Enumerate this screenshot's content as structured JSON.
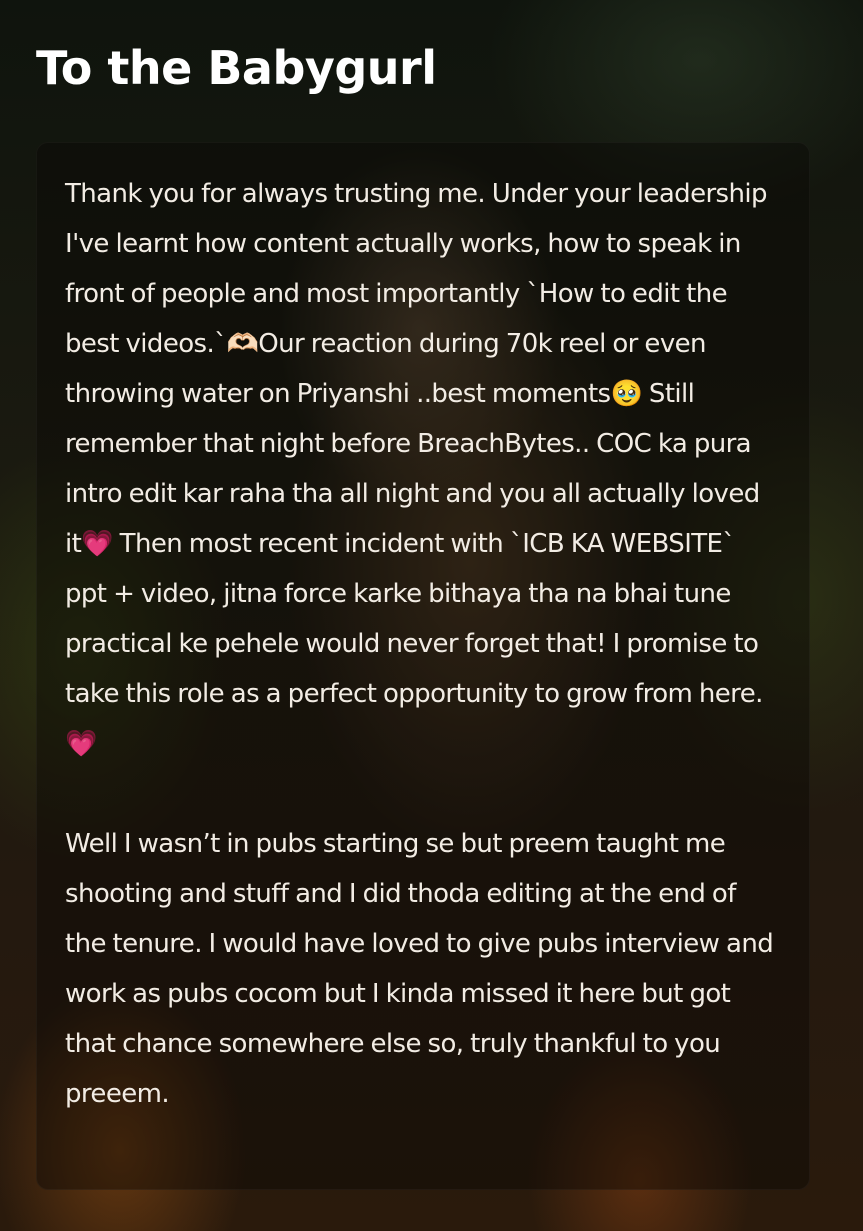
{
  "header": {
    "title": "To the Babygurl"
  },
  "letter": {
    "paragraphs": [
      "Thank you for always trusting me. Under your leadership I've learnt how content actually works, how to speak in front of people and most importantly `How to edit the best videos.`🫶🏻Our reaction during 70k reel or even throwing water on Priyanshi ..best moments🥹 Still remember that night before BreachBytes.. COC ka pura intro edit kar raha tha all night and you all actually loved it💗 Then most recent incident with `ICB KA WEBSITE` ppt + video, jitna force karke bithaya tha na bhai tune practical ke pehele would never forget that! I promise to take this role as a perfect opportunity to grow from here.💗",
      "Well I wasn’t in pubs starting se but preem taught me shooting and stuff and I did thoda editing at the end of the tenure. I would have loved to give pubs interview and work as pubs cocom but I kinda missed it here but got that chance somewhere else so, truly thankful to you preeem."
    ]
  }
}
